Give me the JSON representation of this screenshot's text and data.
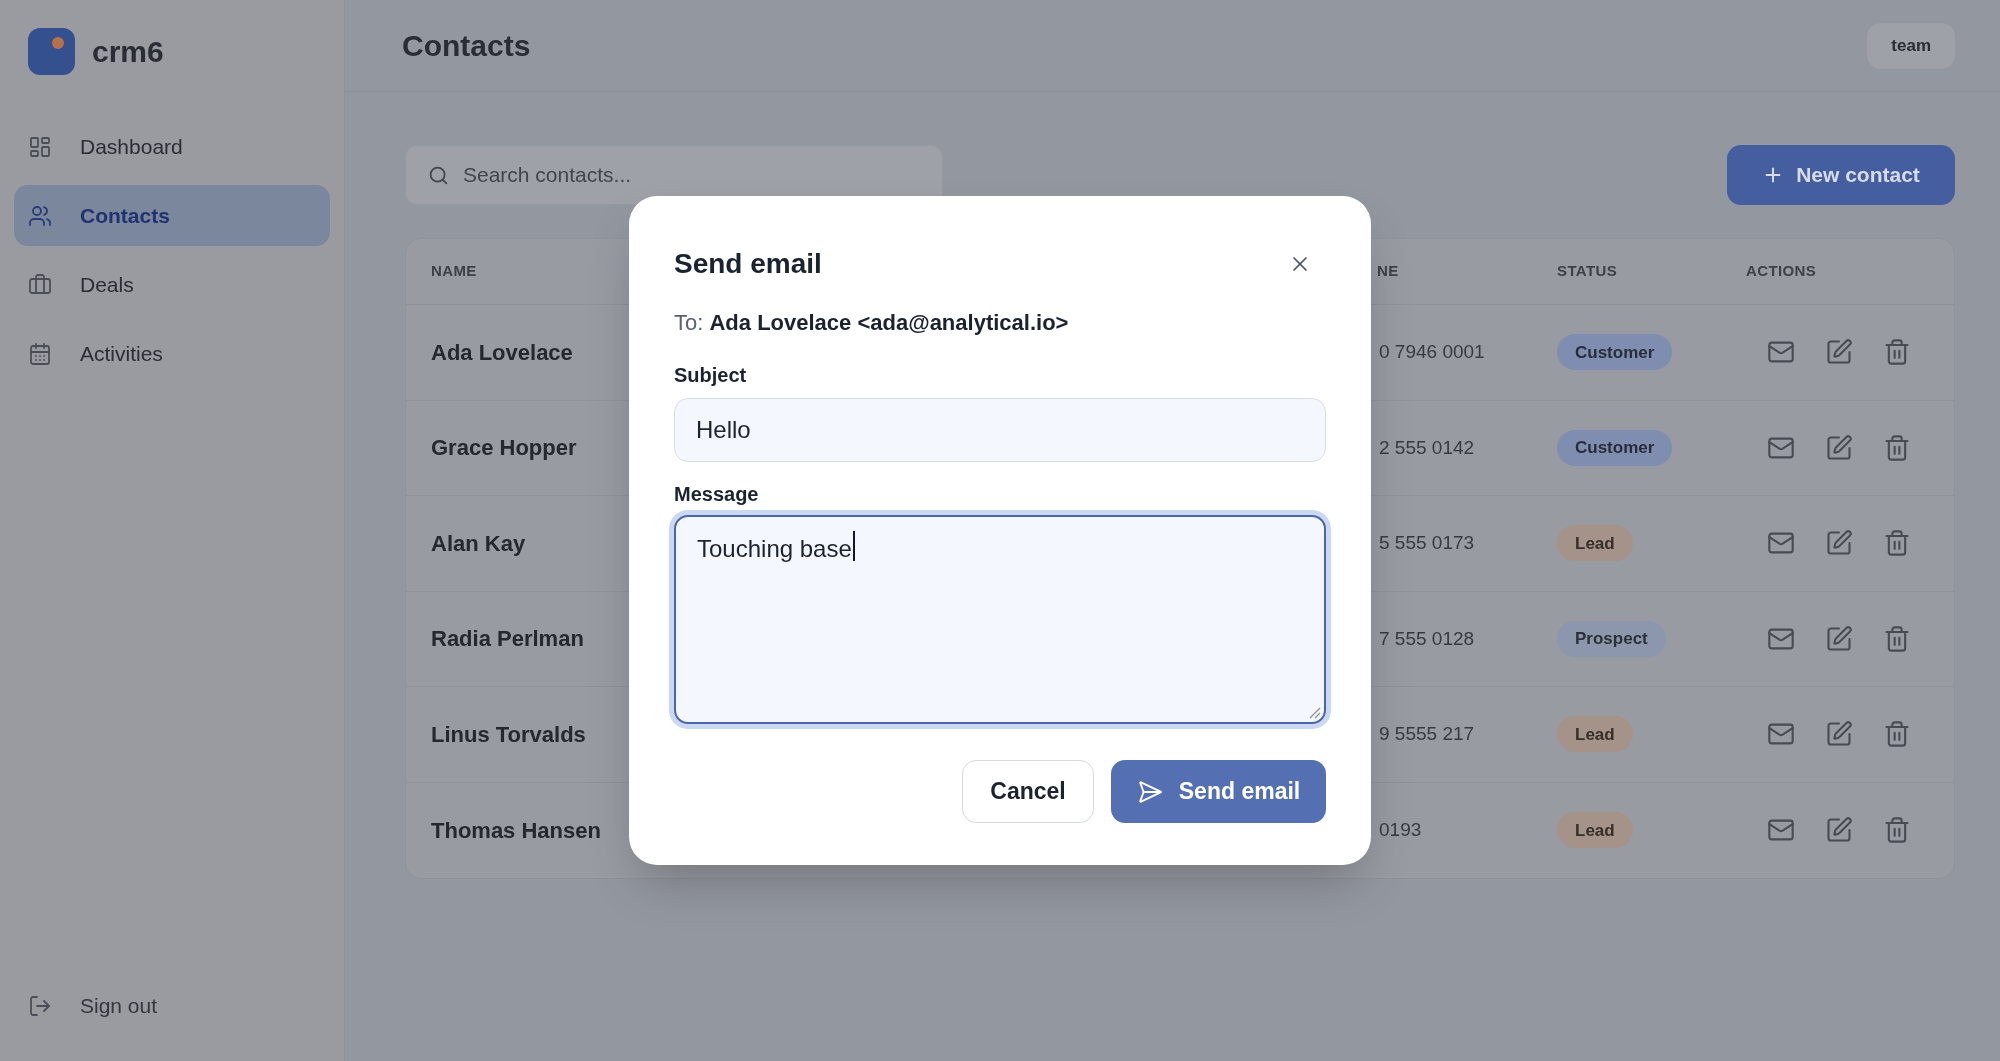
{
  "sidebar": {
    "logo": "crm6",
    "items": [
      {
        "label": "Dashboard",
        "selected": false
      },
      {
        "label": "Contacts",
        "selected": true
      },
      {
        "label": "Deals",
        "selected": false
      },
      {
        "label": "Activities",
        "selected": false
      }
    ],
    "sign_out": "Sign out"
  },
  "header": {
    "title": "Contacts",
    "user_button": "team"
  },
  "toolbar": {
    "search": {
      "placeholder": "Search contacts..."
    },
    "new_button": "New contact"
  },
  "table": {
    "columns": [
      "NAME",
      "NE",
      "STATUS",
      "ACTIONS"
    ],
    "rows": [
      {
        "name": "Ada Lovelace",
        "phone": "0 7946 0001",
        "status": {
          "label": "Customer",
          "color": "#7f8eb0"
        }
      },
      {
        "name": "Grace Hopper",
        "phone": "2 555 0142",
        "status": {
          "label": "Customer",
          "color": "#7f8eb0"
        }
      },
      {
        "name": "Alan Kay",
        "phone": "5 555 0173",
        "status": {
          "label": "Lead",
          "color": "#a59389"
        }
      },
      {
        "name": "Radia Perlman",
        "phone": "7 555 0128",
        "status": {
          "label": "Prospect",
          "color": "#8c96ad"
        }
      },
      {
        "name": "Linus Torvalds",
        "phone": "9 5555 217",
        "status": {
          "label": "Lead",
          "color": "#a59389"
        }
      },
      {
        "name": "Thomas Hansen",
        "phone": "0193",
        "status": {
          "label": "Lead",
          "color": "#a59389"
        }
      }
    ]
  },
  "dialog": {
    "title": "Send email",
    "recipient": "To: **Ada Lovelace <ada@analytical.io>**",
    "fields": [
      {
        "kind": "input",
        "label": "Subject",
        "value": "Hello",
        "focused": false
      },
      {
        "kind": "textarea",
        "label": "Message",
        "value": "Touching base",
        "focused": true
      }
    ],
    "buttons": [
      {
        "kind": "secondary",
        "label": "Cancel"
      },
      {
        "kind": "primary",
        "label": "Send email"
      }
    ]
  }
}
